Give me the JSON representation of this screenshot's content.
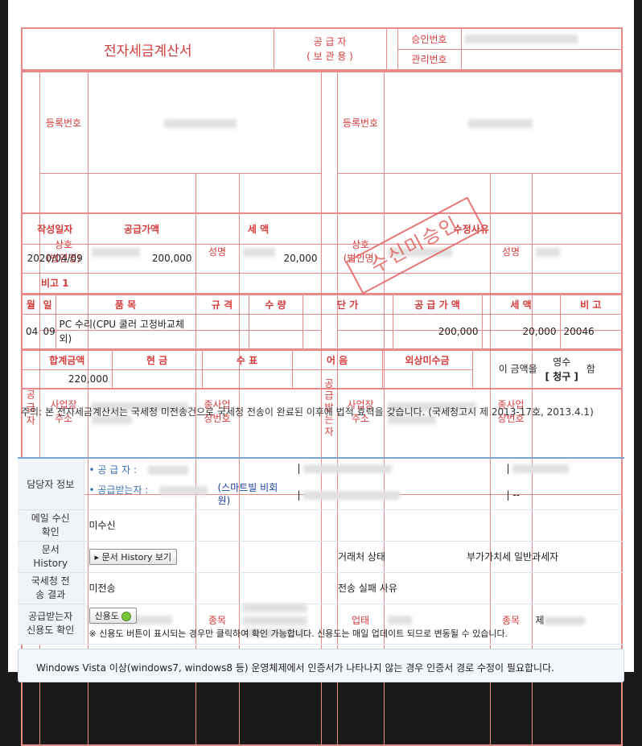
{
  "doc": {
    "title": "전자세금계산서",
    "supplier_role": "공 급 자",
    "supplier_role_sub": "( 보 관 용 )",
    "approval_no_label": "승인번호",
    "mgmt_no_label": "관리번호",
    "supplier_side_label": "공급자",
    "buyer_side_label": "공급받는자",
    "reg_no_label": "등록번호",
    "company_label": "상호\n(법인명)",
    "name_label": "성명",
    "address_label": "사업장\n주소",
    "branch_label": "종사업\n장번호",
    "business_type_label": "업태",
    "business_item_label": "종목",
    "buyer_item_visible": "제",
    "date_label": "작성일자",
    "supply_amount_label": "공급가액",
    "tax_label": "세 액",
    "revision_reason_label": "수정사유",
    "date_value": "2020/04/09",
    "supply_amount_value": "200,000",
    "tax_value": "20,000",
    "remark_label": "비고 1",
    "items_header": {
      "month": "월",
      "day": "일",
      "item": "품 목",
      "spec": "규 격",
      "qty": "수 량",
      "unit_price": "단 가",
      "supply": "공 급 가 액",
      "tax": "세 액",
      "remark": "비 고"
    },
    "item_row": {
      "month": "04",
      "day": "09",
      "item": "PC 수리(CPU 쿨러 고정바교체 외)",
      "supply": "200,000",
      "tax": "20,000",
      "remark": "20046"
    },
    "totals_header": {
      "total": "합계금액",
      "cash": "현 금",
      "check": "수 표",
      "note": "어 음",
      "credit": "외상미수금"
    },
    "total_value": "220,000",
    "amount_text": "이 금액을",
    "receipt": "영수",
    "claim": "[ 청구 ]",
    "ham": "함",
    "stamp": "수신미승인"
  },
  "notice": "주의: 본 전자세금계산서는 국세청 미전송건으로 국세청 전송이 완료된 이후에 법적 효력을 갖습니다. (국세청고시 제 2013-17호, 2013.4.1)",
  "info": {
    "contact_label": "담당자 정보",
    "supplier_label": "• 공   급   자 :",
    "buyer_label": "• 공급받는자 :",
    "smartbill": "(스마트빌 비회원)",
    "dash": "| --",
    "mail_label": "메일 수신\n확인",
    "mail_value": "미수신",
    "history_label": "문서\nHistory",
    "history_button": "▸ 문서 History 보기",
    "partner_status_label": "거래처 상태",
    "partner_status_value": "부가가치세 일반과세자",
    "nts_label": "국세청 전\n송 결과",
    "nts_value": "미전송",
    "fail_reason_label": "전송 실패 사유",
    "credit_label": "공급받는자\n신용도 확인",
    "credit_button": "신용도",
    "credit_note": "※ 신용도 버튼이 표시되는 경우만 클릭하여 확인 가능합니다. 신용도는 매일 업데이트 되므로 변동될 수 있습니다."
  },
  "bottom_notice": "Windows Vista 이상(windows7, windows8 등) 운영체제에서 인증서가 나타나지 않는 경우 인증서 경로 수정이 필요합니다."
}
